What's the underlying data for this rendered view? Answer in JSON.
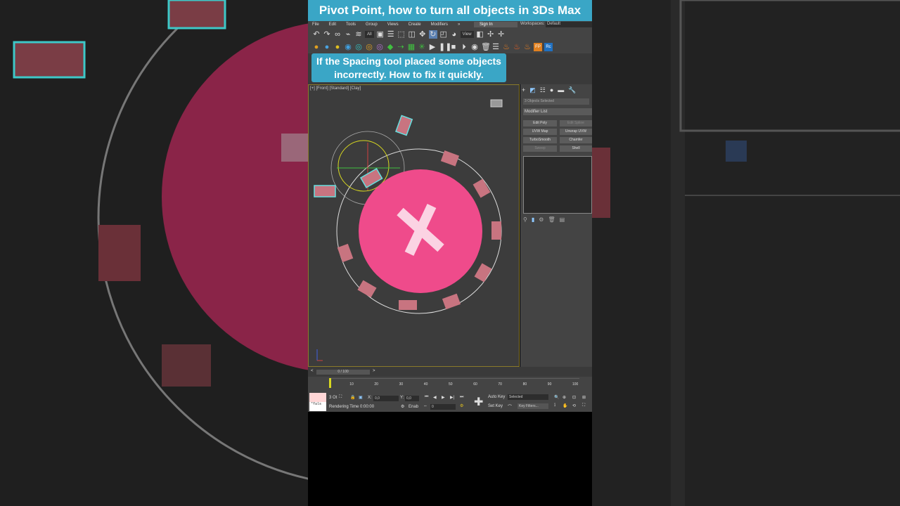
{
  "title": "Pivot Point, how to turn all objects in 3Ds Max",
  "caption": {
    "line1": "If the Spacing tool placed some objects",
    "line2": "incorrectly. How to fix it quickly."
  },
  "menu": [
    "File",
    "Edit",
    "Tools",
    "Group",
    "Views",
    "Create",
    "Modifiers"
  ],
  "menu_more": "»",
  "signin": "Sign In",
  "workspaces_label": "Workspaces:",
  "workspaces_value": "Default",
  "filter_value": "All",
  "view_value": "View",
  "viewport_label": "[+] [Front] [Standard] [Clay]",
  "objects_selected": "3 Objects Selected",
  "modifier_list": "Modifier List",
  "modifiers": [
    "Edit Poly",
    "Edit Spline",
    "UVW Map",
    "Unwrap UVW",
    "TurboSmooth",
    "Chamfer",
    "Sweep",
    "Shell"
  ],
  "time_slider": "0 / 100",
  "ticks": [
    "10",
    "20",
    "30",
    "40",
    "50",
    "60",
    "70",
    "80",
    "90",
    "100"
  ],
  "status": {
    "selected_count": "3 Ot",
    "rendering_time": "Rendering Time  0:00:00",
    "x_label": "X:",
    "x_value": "0,0",
    "y_label": "Y:",
    "y_value": "0,0",
    "auto_key": "Auto Key",
    "selected": "Selected",
    "set_key": "Set Key",
    "key_filters": "Key Filters...",
    "frame": "0",
    "enab": "Enab",
    "script": "\"fals"
  },
  "colors": {
    "accent": "#3aa6c6",
    "pink": "#ef4b8b",
    "selection": "#66e0e0",
    "object": "#c87480"
  }
}
